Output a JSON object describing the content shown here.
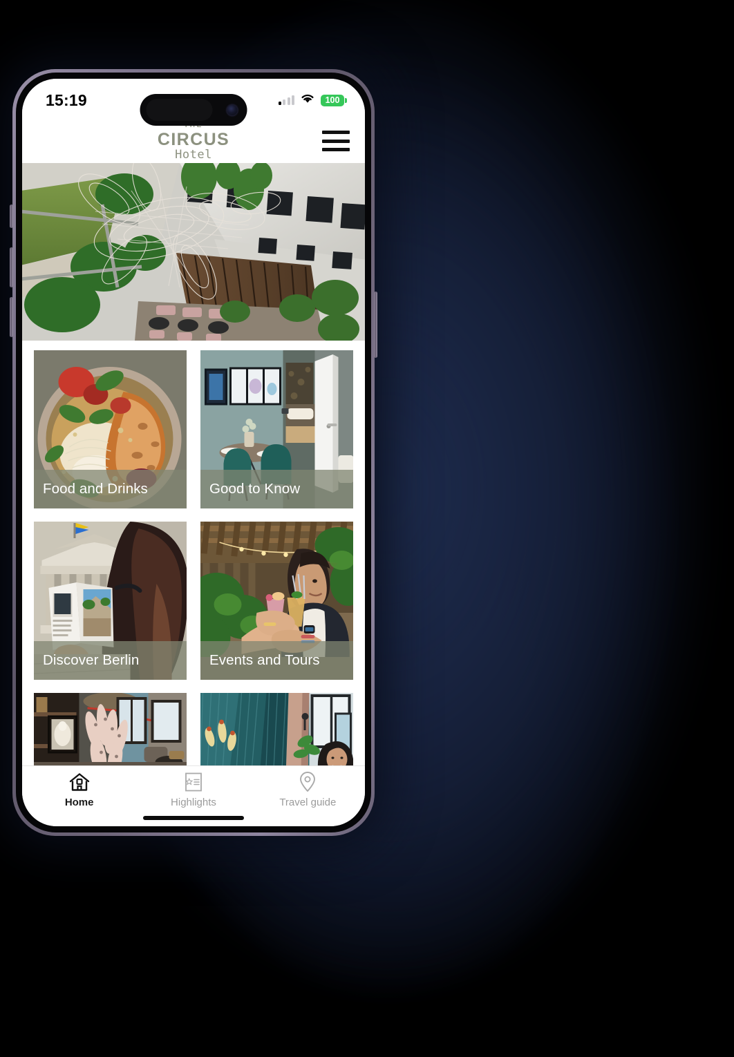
{
  "device": {
    "status_bar": {
      "clock": "15:19",
      "battery_level": "100",
      "battery_color": "#35c759",
      "cellular_icon": "signal-bars-icon",
      "wifi_icon": "wifi-icon"
    },
    "home_indicator": "home-indicator"
  },
  "app_header": {
    "logo_line1": "THE",
    "logo_line2": "CIRCUS",
    "logo_line3": "Hotel",
    "logo_color": "#8c917f",
    "menu_icon": "hamburger-menu-icon"
  },
  "hero": {
    "alt": "Aerial view of hotel courtyard with wire mesh sculpture and green roof terrace"
  },
  "cards": [
    {
      "label": "Food and Drinks",
      "alt": "Bowl of food with bread, tomatoes and herbs"
    },
    {
      "label": "Good to Know",
      "alt": "Hotel room interior with dining table and open door"
    },
    {
      "label": "Discover Berlin",
      "alt": "Woman reading guidebook in front of Berlin museum"
    },
    {
      "label": "Events and Tours",
      "alt": "People toasting cocktails in a garden bar"
    },
    {
      "label": "",
      "alt": "Hotel lobby interior with artwork and dried flowers"
    },
    {
      "label": "",
      "alt": "Teal panelled interior with woman by the window"
    }
  ],
  "overlay_color": "#808671",
  "tabbar": {
    "items": [
      {
        "label": "Home",
        "icon": "house-icon",
        "active": true
      },
      {
        "label": "Highlights",
        "icon": "list-star-icon",
        "active": false
      },
      {
        "label": "Travel guide",
        "icon": "map-pin-icon",
        "active": false
      }
    ]
  }
}
